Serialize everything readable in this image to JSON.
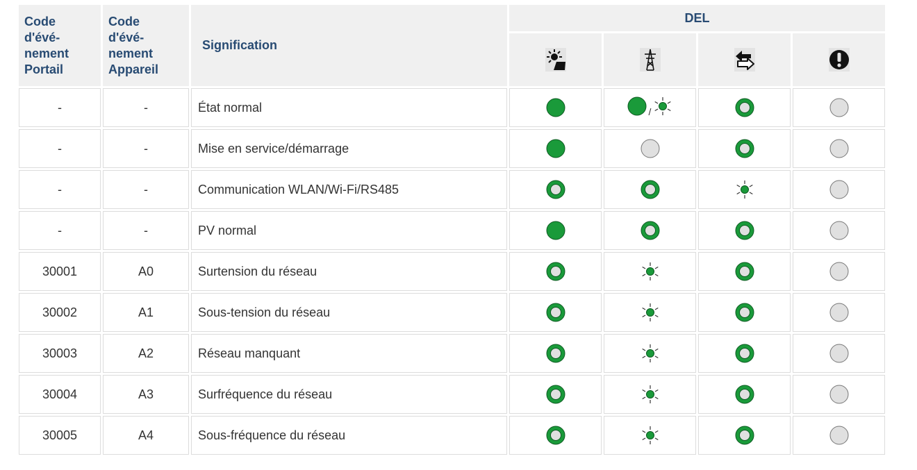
{
  "header": {
    "col1": [
      "Code",
      "d'évé-",
      "nement",
      "Portail"
    ],
    "col2": [
      "Code",
      "d'évé-",
      "nement",
      "Appareil"
    ],
    "meaning": "Signification",
    "led_group": "DEL",
    "led_icons": [
      "solar-panel-icon",
      "grid-pylon-icon",
      "communication-arrows-icon",
      "warning-icon"
    ]
  },
  "led_legend": {
    "on": "solid green",
    "ok": "green ring with grey center",
    "blink": "flashing green",
    "off": "grey",
    "on_or_blink": "solid or flashing",
    "slash": "/"
  },
  "colors": {
    "header_text": "#284b73",
    "header_bg": "#f0f0f0",
    "led_green": "#1a9a3a",
    "led_grey": "#e0e0e0"
  },
  "rows": [
    {
      "portal": "-",
      "device": "-",
      "meaning": "État normal",
      "leds": [
        "on",
        "on_or_blink",
        "ok",
        "off"
      ]
    },
    {
      "portal": "-",
      "device": "-",
      "meaning": "Mise en service/démarrage",
      "leds": [
        "on",
        "off",
        "ok",
        "off"
      ]
    },
    {
      "portal": "-",
      "device": "-",
      "meaning": "Communication WLAN/Wi-Fi/RS485",
      "leds": [
        "ok",
        "ok",
        "blink",
        "off"
      ]
    },
    {
      "portal": "-",
      "device": "-",
      "meaning": "PV normal",
      "leds": [
        "on",
        "ok",
        "ok",
        "off"
      ]
    },
    {
      "portal": "30001",
      "device": "A0",
      "meaning": "Surtension du réseau",
      "leds": [
        "ok",
        "blink",
        "ok",
        "off"
      ]
    },
    {
      "portal": "30002",
      "device": "A1",
      "meaning": "Sous-tension du réseau",
      "leds": [
        "ok",
        "blink",
        "ok",
        "off"
      ]
    },
    {
      "portal": "30003",
      "device": "A2",
      "meaning": "Réseau manquant",
      "leds": [
        "ok",
        "blink",
        "ok",
        "off"
      ]
    },
    {
      "portal": "30004",
      "device": "A3",
      "meaning": "Surfréquence du réseau",
      "leds": [
        "ok",
        "blink",
        "ok",
        "off"
      ]
    },
    {
      "portal": "30005",
      "device": "A4",
      "meaning": "Sous-fréquence du réseau",
      "leds": [
        "ok",
        "blink",
        "ok",
        "off"
      ]
    }
  ]
}
